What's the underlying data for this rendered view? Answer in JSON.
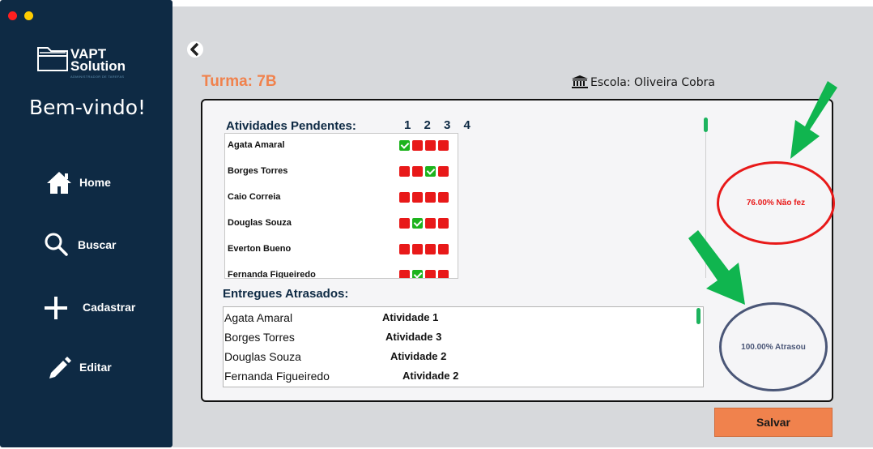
{
  "window": {
    "controls": [
      "close",
      "minimize"
    ]
  },
  "logo": {
    "title_line1": "VAPT",
    "title_line2": "Solution",
    "subtitle": "ADMINISTRADOR DE TAREFAS"
  },
  "sidebar": {
    "welcome": "Bem-vindo!",
    "items": [
      {
        "label": "Home",
        "icon": "home-icon"
      },
      {
        "label": "Buscar",
        "icon": "search-icon"
      },
      {
        "label": "Cadastrar",
        "icon": "plus-icon"
      },
      {
        "label": "Editar",
        "icon": "pencil-icon"
      }
    ]
  },
  "header": {
    "turma": "Turma: 7B",
    "escola": "Escola: Oliveira Cobra"
  },
  "pendentes": {
    "title": "Atividades Pendentes:",
    "columns": "1 2 3 4",
    "rows": [
      {
        "name": "Agata Amaral",
        "status": [
          true,
          false,
          false,
          false
        ]
      },
      {
        "name": "Borges Torres",
        "status": [
          false,
          false,
          true,
          false
        ]
      },
      {
        "name": "Caio Correia",
        "status": [
          false,
          false,
          false,
          false
        ]
      },
      {
        "name": "Douglas Souza",
        "status": [
          false,
          true,
          false,
          false
        ]
      },
      {
        "name": "Everton Bueno",
        "status": [
          false,
          false,
          false,
          false
        ]
      },
      {
        "name": "Fernanda Figueiredo",
        "status": [
          false,
          true,
          false,
          false
        ]
      }
    ]
  },
  "atrasados": {
    "title": "Entregues Atrasados:",
    "rows": [
      {
        "name": "Agata Amaral",
        "activity": "Atividade 1"
      },
      {
        "name": "Borges Torres",
        "activity": "Atividade 3"
      },
      {
        "name": "Douglas Souza",
        "activity": "Atividade 2"
      },
      {
        "name": "Fernanda Figueiredo",
        "activity": "Atividade 2"
      }
    ]
  },
  "stats": {
    "nao_fez": "76.00% Não fez",
    "atrasou": "100.00% Atrasou"
  },
  "actions": {
    "save_label": "Salvar"
  },
  "colors": {
    "sidebar": "#0e2a44",
    "accent": "#f0824d",
    "ok": "#1db31d",
    "pending": "#e81919",
    "arrow": "#10b54f"
  }
}
